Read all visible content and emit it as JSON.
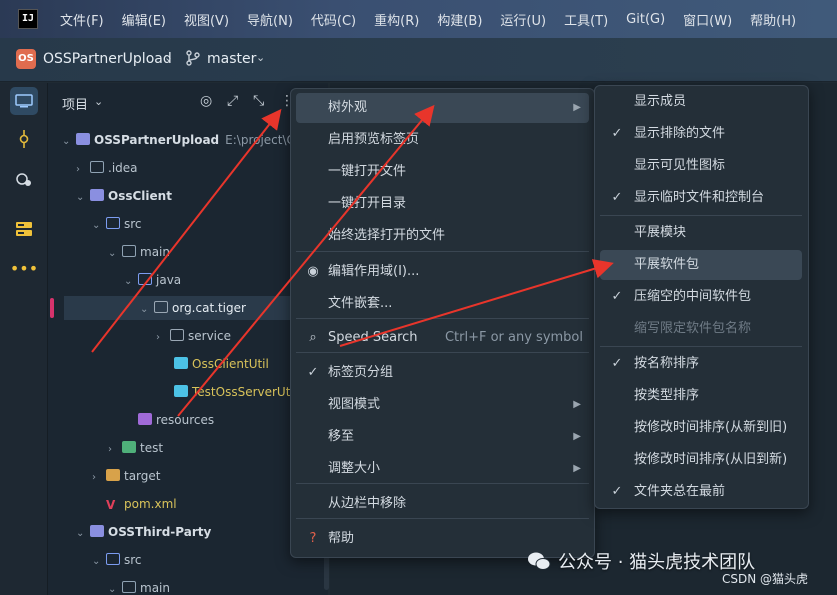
{
  "app": {
    "logo": "IJ"
  },
  "menubar": [
    "文件(F)",
    "编辑(E)",
    "视图(V)",
    "导航(N)",
    "代码(C)",
    "重构(R)",
    "构建(B)",
    "运行(U)",
    "工具(T)",
    "Git(G)",
    "窗口(W)",
    "帮助(H)"
  ],
  "toolbar": {
    "project_badge": "OS",
    "project_name": "OSSPartnerUpload",
    "branch": "master"
  },
  "panel": {
    "title": "项目"
  },
  "tree": [
    {
      "label": "OSSPartnerUpload",
      "extra": "E:\\project\\OSS",
      "icon": "module",
      "arrow": "down",
      "bold": true
    },
    {
      "label": ".idea",
      "icon": "folder",
      "arrow": "right"
    },
    {
      "label": "OssClient",
      "icon": "module",
      "arrow": "down",
      "bold": true
    },
    {
      "label": "src",
      "icon": "src",
      "arrow": "down"
    },
    {
      "label": "main",
      "icon": "folder",
      "arrow": "down"
    },
    {
      "label": "java",
      "icon": "src",
      "arrow": "down"
    },
    {
      "label": "org.cat.tiger",
      "icon": "pkg",
      "arrow": "down",
      "selected": true
    },
    {
      "label": "service",
      "icon": "pkg",
      "arrow": "right"
    },
    {
      "label": "OssClientUtil",
      "icon": "java-class",
      "arrow": "",
      "yellow": true
    },
    {
      "label": "TestOssServerUtil",
      "icon": "java-class",
      "arrow": "",
      "yellow": true
    },
    {
      "label": "resources",
      "icon": "res",
      "arrow": ""
    },
    {
      "label": "test",
      "icon": "test",
      "arrow": "right"
    },
    {
      "label": "target",
      "icon": "target",
      "arrow": "right"
    },
    {
      "label": "pom.xml",
      "icon": "maven",
      "arrow": "",
      "yellow": true
    },
    {
      "label": "OSSThird-Party",
      "icon": "module",
      "arrow": "down",
      "bold": true
    },
    {
      "label": "src",
      "icon": "src",
      "arrow": "down"
    },
    {
      "label": "main",
      "icon": "folder",
      "arrow": "down"
    }
  ],
  "menu1": {
    "items": [
      {
        "label": "树外观",
        "submenu": true,
        "highlight": true
      },
      {
        "label": "启用预览标签页"
      },
      {
        "label": "一键打开文件"
      },
      {
        "label": "一键打开目录"
      },
      {
        "label": "始终选择打开的文件"
      },
      {
        "label": "编辑作用域(I)...",
        "lead": "◉"
      },
      {
        "label": "文件嵌套..."
      },
      {
        "label": "Speed Search",
        "lead": "⌕",
        "hint": "Ctrl+F or any symbol"
      },
      {
        "label": "标签页分组",
        "lead": "✓"
      },
      {
        "label": "视图模式",
        "submenu": true
      },
      {
        "label": "移至",
        "submenu": true
      },
      {
        "label": "调整大小",
        "submenu": true
      },
      {
        "label": "从边栏中移除"
      },
      {
        "label": "帮助",
        "lead": "?"
      }
    ]
  },
  "menu2": {
    "items": [
      {
        "label": "显示成员"
      },
      {
        "label": "显示排除的文件",
        "checked": true
      },
      {
        "label": "显示可见性图标"
      },
      {
        "label": "显示临时文件和控制台",
        "checked": true
      },
      {
        "label": "平展模块"
      },
      {
        "label": "平展软件包",
        "highlight": true
      },
      {
        "label": "压缩空的中间软件包",
        "checked": true
      },
      {
        "label": "缩写限定软件包名称",
        "disabled": true
      },
      {
        "label": "按名称排序",
        "checked": true
      },
      {
        "label": "按类型排序"
      },
      {
        "label": "按修改时间排序(从新到旧)"
      },
      {
        "label": "按修改时间排序(从旧到新)"
      },
      {
        "label": "文件夹总在最前",
        "checked": true
      }
    ]
  },
  "watermark": {
    "text": "公众号 · 猫头虎技术团队",
    "csdn": "CSDN @猫头虎"
  },
  "colors": {
    "accent": "#3a4855",
    "arrow": "#e8352b",
    "selection_marker": "#d6336c"
  }
}
